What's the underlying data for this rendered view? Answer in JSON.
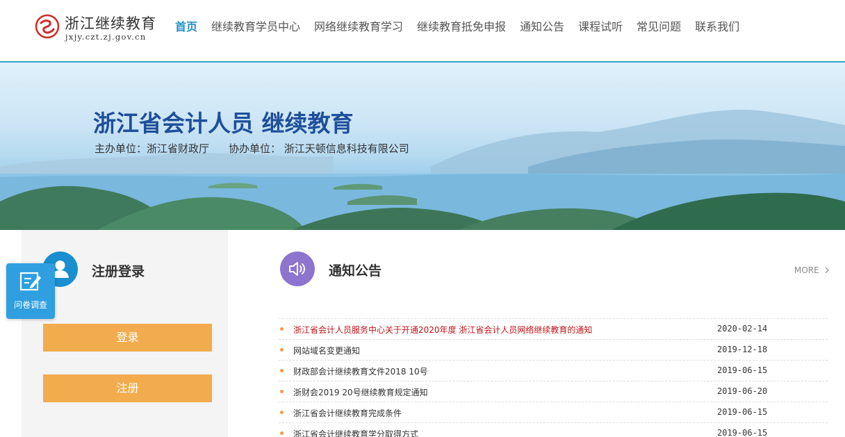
{
  "header": {
    "logo_name": "浙江继续教育",
    "logo_domain": "jxjy.czt.zj.gov.cn",
    "nav": [
      {
        "label": "首页",
        "active": true
      },
      {
        "label": "继续教育学员中心"
      },
      {
        "label": "网络继续教育学习"
      },
      {
        "label": "继续教育抵免申报"
      },
      {
        "label": "通知公告"
      },
      {
        "label": "课程试听"
      },
      {
        "label": "常见问题"
      },
      {
        "label": "联系我们"
      }
    ]
  },
  "banner": {
    "title": "浙江省会计人员 继续教育",
    "host": "主办单位：浙江省财政厅",
    "co_host": "协办单位： 浙江天顿信息科技有限公司"
  },
  "login_panel": {
    "title": "注册登录",
    "login_label": "登录",
    "register_label": "注册"
  },
  "survey": {
    "label": "问卷调查"
  },
  "notices": {
    "title": "通知公告",
    "more_label": "MORE",
    "items": [
      {
        "text": "浙江省会计人员服务中心关于开通2020年度 浙江省会计人员网络继续教育的通知",
        "date": "2020-02-14"
      },
      {
        "text": "网站域名变更通知",
        "date": "2019-12-18"
      },
      {
        "text": "财政部会计继续教育文件2018 10号",
        "date": "2019-06-15"
      },
      {
        "text": "浙财会2019 20号继续教育规定通知",
        "date": "2019-06-20"
      },
      {
        "text": "浙江省会计继续教育完成条件",
        "date": "2019-06-15"
      },
      {
        "text": "浙江省会计继续教育学分取得方式",
        "date": "2019-06-15"
      }
    ]
  },
  "colors": {
    "nav_active": "#1f8fc6",
    "header_line": "#33a4c9",
    "button": "#f2ac4d",
    "user_icon_bg": "#1a8fd0",
    "notice_icon_bg": "#8d74cf",
    "survey_bg": "#2f9fe0",
    "highlight_text": "#c0141a",
    "bullet": "#f29a4a"
  }
}
